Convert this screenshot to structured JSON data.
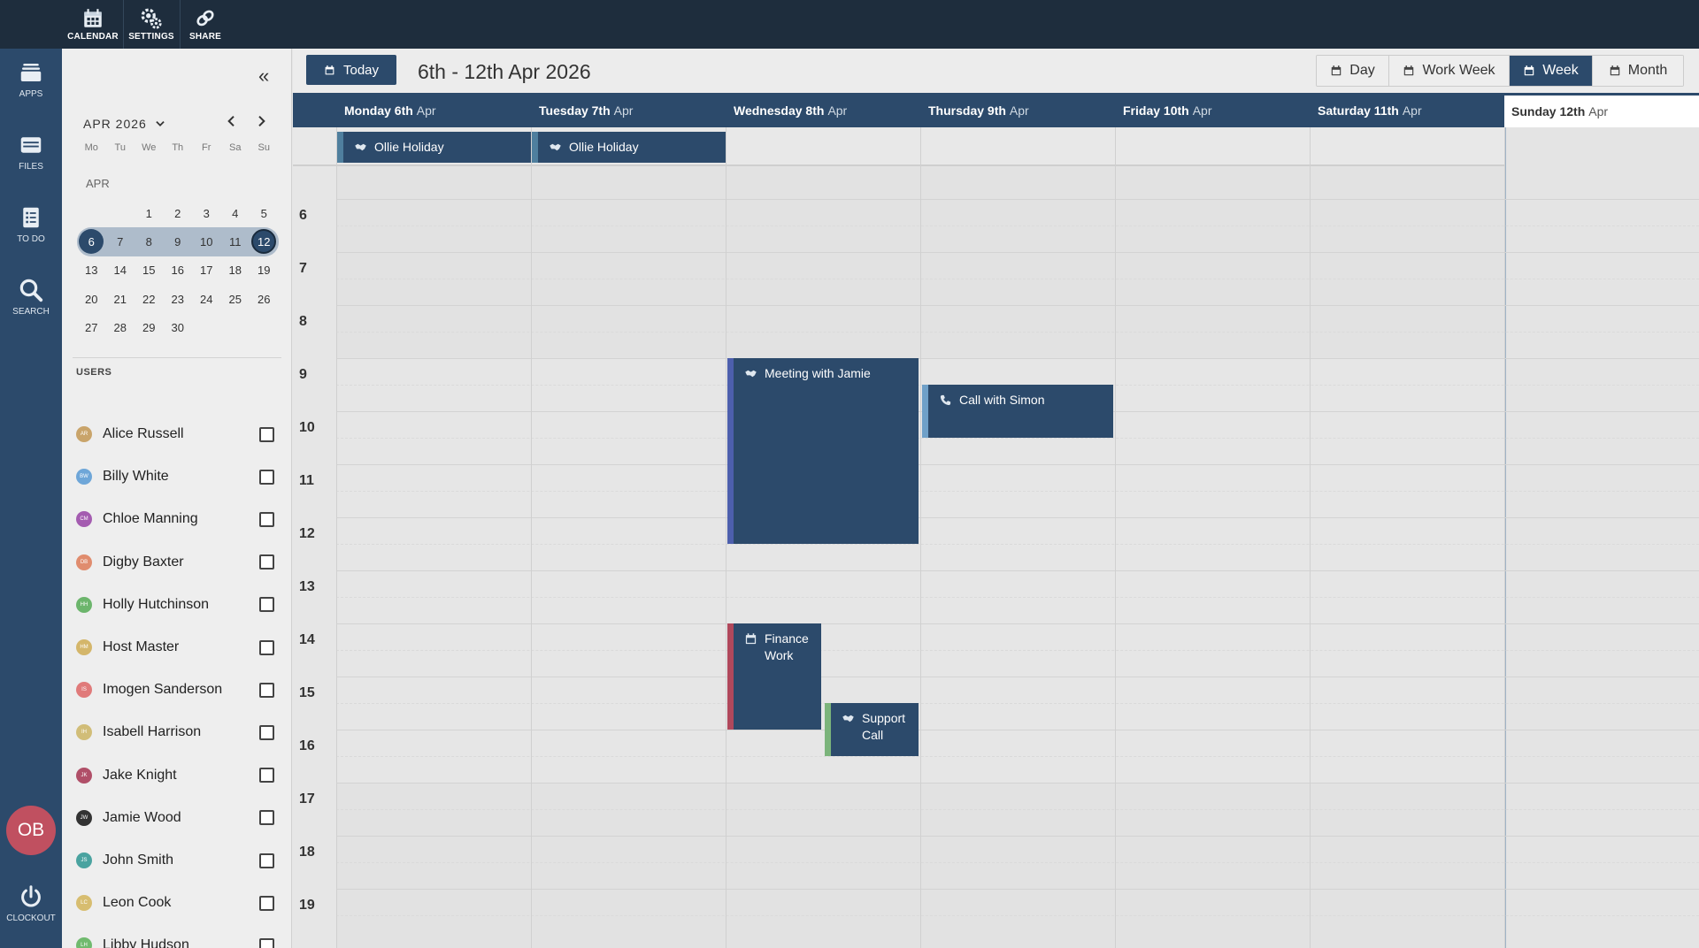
{
  "topbar": {
    "tools": [
      {
        "label": "CALENDAR",
        "icon": "calendar-icon"
      },
      {
        "label": "SETTINGS",
        "icon": "gear-icon"
      },
      {
        "label": "SHARE",
        "icon": "share-link-icon"
      }
    ]
  },
  "rail": {
    "items": [
      {
        "label": "APPS",
        "icon": "apps-icon"
      },
      {
        "label": "FILES",
        "icon": "files-icon"
      },
      {
        "label": "TO DO",
        "icon": "todo-icon"
      },
      {
        "label": "SEARCH",
        "icon": "search-icon"
      }
    ],
    "avatar_initials": "OB",
    "clockout_label": "CLOCKOUT"
  },
  "mini_calendar": {
    "month_label": "APR 2026",
    "dow": [
      "Mo",
      "Tu",
      "We",
      "Th",
      "Fr",
      "Sa",
      "Su"
    ],
    "month_short": "APR",
    "weeks": [
      [
        "",
        "",
        "1",
        "2",
        "3",
        "4",
        "5"
      ],
      [
        "6",
        "7",
        "8",
        "9",
        "10",
        "11",
        "12"
      ],
      [
        "13",
        "14",
        "15",
        "16",
        "17",
        "18",
        "19"
      ],
      [
        "20",
        "21",
        "22",
        "23",
        "24",
        "25",
        "26"
      ],
      [
        "27",
        "28",
        "29",
        "30",
        "",
        "",
        ""
      ]
    ],
    "selected_week_index": 1
  },
  "users": {
    "title": "USERS",
    "list": [
      {
        "name": "Alice Russell",
        "initials": "AR",
        "color": "#c9a46a"
      },
      {
        "name": "Billy White",
        "initials": "BW",
        "color": "#6ea6d8"
      },
      {
        "name": "Chloe Manning",
        "initials": "CM",
        "color": "#a45cb0"
      },
      {
        "name": "Digby Baxter",
        "initials": "DB",
        "color": "#e08c6e"
      },
      {
        "name": "Holly Hutchinson",
        "initials": "HH",
        "color": "#6cb56c"
      },
      {
        "name": "Host Master",
        "initials": "HM",
        "color": "#d4b66a"
      },
      {
        "name": "Imogen Sanderson",
        "initials": "IS",
        "color": "#e07a7a"
      },
      {
        "name": "Isabell Harrison",
        "initials": "IH",
        "color": "#d1bd78"
      },
      {
        "name": "Jake Knight",
        "initials": "JK",
        "color": "#b04f68"
      },
      {
        "name": "Jamie Wood",
        "initials": "JW",
        "color": "#333333"
      },
      {
        "name": "John Smith",
        "initials": "JS",
        "color": "#4aa3a0"
      },
      {
        "name": "Leon Cook",
        "initials": "LC",
        "color": "#d7bd70"
      },
      {
        "name": "Libby Hudson",
        "initials": "LH",
        "color": "#70ba6e"
      }
    ]
  },
  "header": {
    "today_label": "Today",
    "range_label": "6th - 12th Apr 2026",
    "views": [
      {
        "label": "Day",
        "active": false
      },
      {
        "label": "Work Week",
        "active": false
      },
      {
        "label": "Week",
        "active": true
      },
      {
        "label": "Month",
        "active": false
      }
    ]
  },
  "week": {
    "days": [
      {
        "name": "Monday 6th",
        "month": "Apr"
      },
      {
        "name": "Tuesday 7th",
        "month": "Apr"
      },
      {
        "name": "Wednesday 8th",
        "month": "Apr"
      },
      {
        "name": "Thursday 9th",
        "month": "Apr"
      },
      {
        "name": "Friday 10th",
        "month": "Apr"
      },
      {
        "name": "Saturday 11th",
        "month": "Apr"
      },
      {
        "name": "Sunday 12th",
        "month": "Apr"
      }
    ],
    "hours": [
      "6",
      "7",
      "8",
      "9",
      "10",
      "11",
      "12",
      "13",
      "14",
      "15",
      "16",
      "17",
      "18",
      "19"
    ],
    "all_day_events": [
      {
        "title": "Ollie Holiday",
        "day": 0,
        "icon": "handshake-icon"
      },
      {
        "title": "Ollie Holiday",
        "day": 1,
        "icon": "handshake-icon"
      }
    ],
    "events": [
      {
        "title": "Meeting with Jamie",
        "day": 2,
        "start": 9.0,
        "end": 12.5,
        "type": "meeting",
        "icon": "handshake-icon"
      },
      {
        "title": "Call with Simon",
        "day": 3,
        "start": 9.5,
        "end": 10.5,
        "type": "call",
        "icon": "phone-icon"
      },
      {
        "title": "Finance Work",
        "day": 2,
        "start": 14.0,
        "end": 16.0,
        "type": "finance",
        "icon": "calendar-icon"
      },
      {
        "title": "Support Call",
        "day": 2,
        "start": 15.5,
        "end": 16.5,
        "type": "support",
        "icon": "handshake-icon"
      }
    ]
  }
}
